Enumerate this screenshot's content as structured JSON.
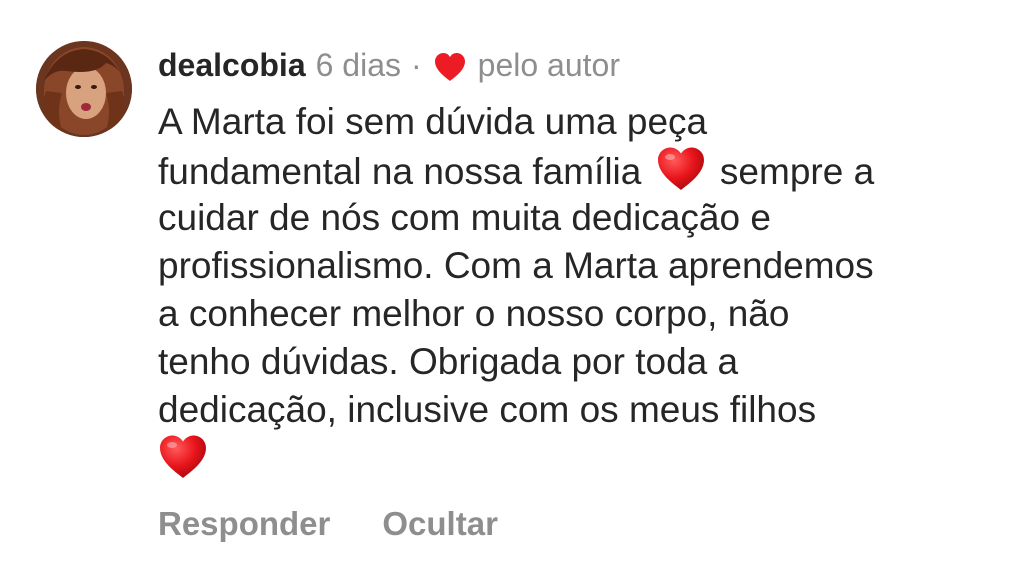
{
  "comment": {
    "username": "dealcobia",
    "time": "6 dias",
    "separator": "·",
    "liked_by_label": "pelo autor",
    "lines": [
      "A Marta foi sem dúvida uma peça",
      "fundamental na nossa família",
      "sempre a",
      "cuidar de nós com muita dedicação e",
      "profissionalismo. Com a Marta aprendemos",
      "a conhecer melhor o nosso corpo, não",
      "tenho dúvidas. Obrigada por toda a",
      "dedicação, inclusive com os meus filhos"
    ]
  },
  "actions": {
    "reply_label": "Responder",
    "hide_label": "Ocultar"
  },
  "icons": {
    "liked_heart": "heart-icon",
    "emoji": "red-heart-emoji"
  },
  "colors": {
    "heart_red": "#ed1c24",
    "meta_gray": "#8e8e8e",
    "text_dark": "#262626"
  }
}
